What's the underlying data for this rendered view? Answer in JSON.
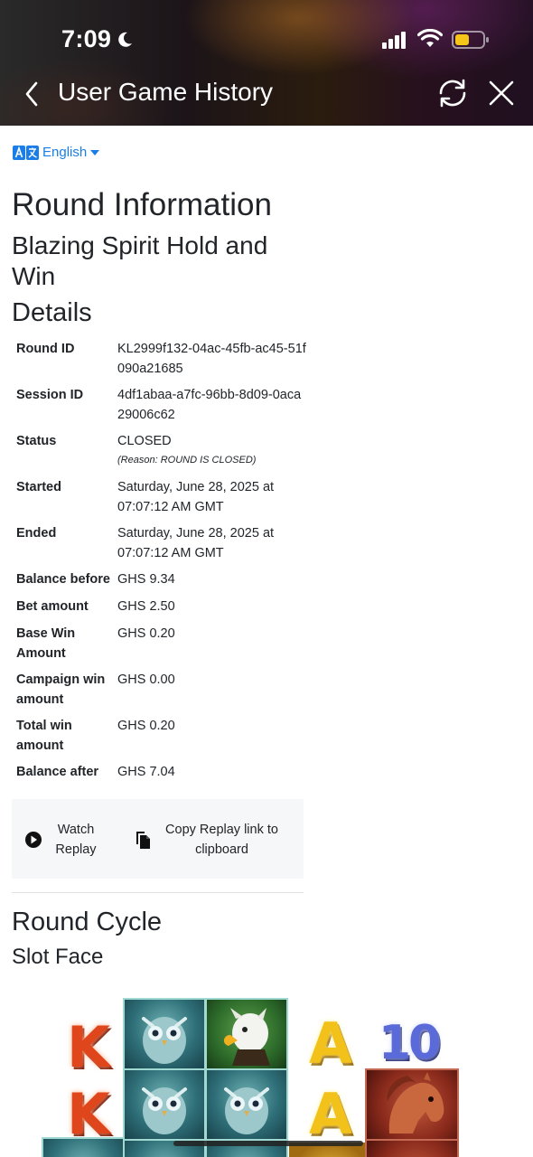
{
  "status_bar": {
    "time": "7:09",
    "icons": [
      "moon-icon",
      "signal-icon",
      "wifi-icon",
      "battery-icon"
    ],
    "battery_color": "#f5c518"
  },
  "header": {
    "title": "User Game History",
    "icons": [
      "back-icon",
      "refresh-icon",
      "close-icon"
    ]
  },
  "language": {
    "label": "English",
    "icon": "translate-icon",
    "color": "#1b7ee6"
  },
  "headings": {
    "round_information": "Round Information",
    "game_name": "Blazing Spirit Hold and Win",
    "details": "Details",
    "round_cycle": "Round Cycle",
    "slot_face": "Slot Face"
  },
  "details": [
    {
      "label": "Round ID",
      "value": "KL2999f132-04ac-45fb-ac45-51f090a21685"
    },
    {
      "label": "Session ID",
      "value": "4df1abaa-a7fc-96bb-8d09-0aca29006c62"
    },
    {
      "label": "Status",
      "value": "CLOSED",
      "note": "(Reason: ROUND IS CLOSED)"
    },
    {
      "label": "Started",
      "value": "Saturday, June 28, 2025 at 07:07:12 AM GMT"
    },
    {
      "label": "Ended",
      "value": "Saturday, June 28, 2025 at 07:07:12 AM GMT"
    },
    {
      "label": "Balance before",
      "value": "GHS 9.34"
    },
    {
      "label": "Bet amount",
      "value": "GHS 2.50"
    },
    {
      "label": "Base Win Amount",
      "value": "GHS 0.20"
    },
    {
      "label": "Campaign win amount",
      "value": "GHS 0.00"
    },
    {
      "label": "Total win amount",
      "value": "GHS 0.20"
    },
    {
      "label": "Balance after",
      "value": "GHS 7.04"
    }
  ],
  "actions": {
    "watch_replay": "Watch Replay",
    "copy_replay": "Copy Replay link to clipboard"
  },
  "slot_face": {
    "symbols": {
      "k": "K",
      "a": "A",
      "ten": "10"
    },
    "grid_icons": [
      "owl-icon",
      "eagle-icon",
      "horse-icon"
    ]
  }
}
